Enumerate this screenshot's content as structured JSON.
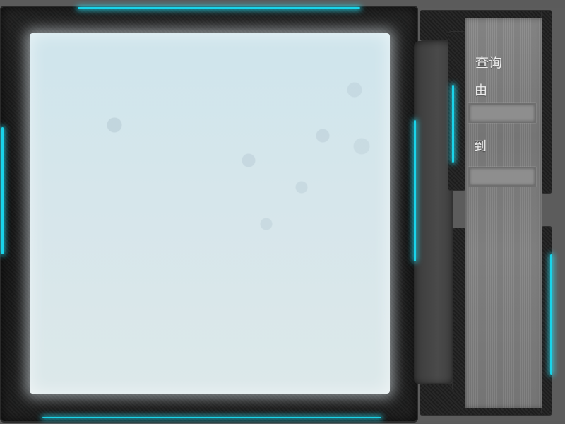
{
  "query_panel": {
    "title": "查询",
    "from_label": "由",
    "from_value": "",
    "to_label": "到",
    "to_value": ""
  },
  "colors": {
    "accent_glow": "#19d4ea",
    "frame": "#1a1a1a",
    "screen": "#d6e6eb",
    "panel_metal": "#808080"
  }
}
